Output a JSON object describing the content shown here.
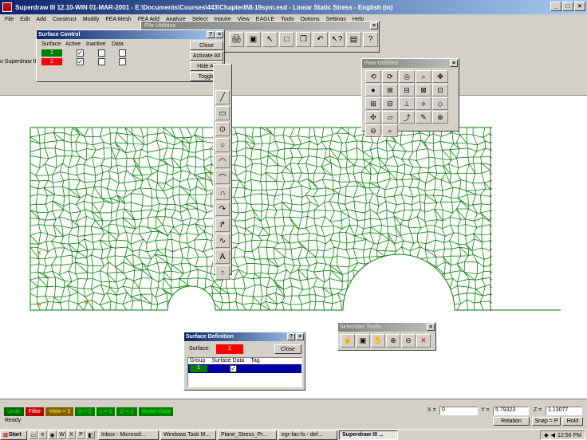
{
  "window": {
    "title": "Superdraw III 12.10-WIN 01-MAR-2001 - E:\\Documents\\Courses\\443\\Chapter8\\8-19sym.esd - Linear Static Stress - English (in)"
  },
  "menu": [
    "File",
    "Edit",
    "Add",
    "Construct",
    "Modify",
    "FEA Mesh",
    "FEA Add",
    "Analyze",
    "Select",
    "Inquire",
    "View",
    "EAGLE",
    "Tools",
    "Options",
    "Settings",
    "Help"
  ],
  "surface_control": {
    "title": "Surface Control",
    "headers": [
      "Surface",
      "Active",
      "Inactive",
      "Data"
    ],
    "rows": [
      {
        "surface": "1",
        "active": "✓",
        "color": "#008000"
      },
      {
        "surface": "2",
        "active": "✓",
        "color": "#ff0000"
      }
    ],
    "buttons": [
      "Close",
      "Activate All",
      "Hide All",
      "Toggle"
    ]
  },
  "file_utilities": {
    "title": "File Utilities"
  },
  "background_label": "o Superdraw III 12.1l",
  "view_utilities": {
    "title": "View Utilities"
  },
  "selection_tools": {
    "title": "Selection Tools"
  },
  "surface_definition": {
    "title": "Surface Definition",
    "surface_label": "Surface:",
    "surface_value": "2",
    "close": "Close",
    "headers": [
      "Group",
      "Surface Data",
      "Tag"
    ],
    "row": {
      "group": "1",
      "check": "✓"
    }
  },
  "status": {
    "chips": [
      "Undo",
      "Filter",
      "View = 5",
      "S = 1",
      "L = 1",
      "G = 1",
      "Model Data"
    ],
    "ready": "Ready",
    "x_label": "X =",
    "x_value": "0",
    "y_label": "Y =",
    "y_value": "5.79323",
    "z_label": "Z =",
    "z_value": "1.13077",
    "relation": "Relation",
    "snap": "Snap = P",
    "hold": "Hold"
  },
  "taskbar": {
    "start": "Start",
    "tasks": [
      "Inbox - Microsof...",
      "Windows Task M...",
      "Plane_Stress_Pr...",
      "egr-fac-fs - def...",
      "Superdraw III ..."
    ],
    "clock": "12:56 PM"
  },
  "colors": {
    "mesh": "#008000",
    "constraint": "#cc0000",
    "surface1": "#008000",
    "surface2": "#ff0000",
    "selected_row": "#0000a0"
  }
}
